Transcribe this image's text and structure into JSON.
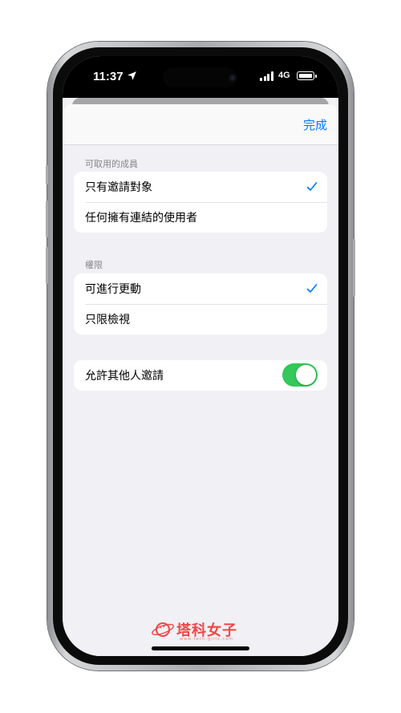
{
  "status_bar": {
    "time": "11:37",
    "network": "4G",
    "location_icon": "location-arrow-icon",
    "signal_bars": 4,
    "battery_level": 1.0
  },
  "nav": {
    "done_label": "完成"
  },
  "members_section": {
    "header": "可取用的成員",
    "options": [
      {
        "label": "只有邀請對象",
        "selected": true
      },
      {
        "label": "任何擁有連結的使用者",
        "selected": false
      }
    ]
  },
  "permissions_section": {
    "header": "權限",
    "options": [
      {
        "label": "可進行更動",
        "selected": true
      },
      {
        "label": "只限檢視",
        "selected": false
      }
    ]
  },
  "invite_setting": {
    "label": "允許其他人邀請",
    "enabled": true
  },
  "watermark": {
    "text": "塔科女子",
    "url": "www.tech-girlz.com"
  },
  "colors": {
    "accent": "#007aff",
    "toggle_on": "#34c759",
    "background": "#f0f0f5"
  }
}
